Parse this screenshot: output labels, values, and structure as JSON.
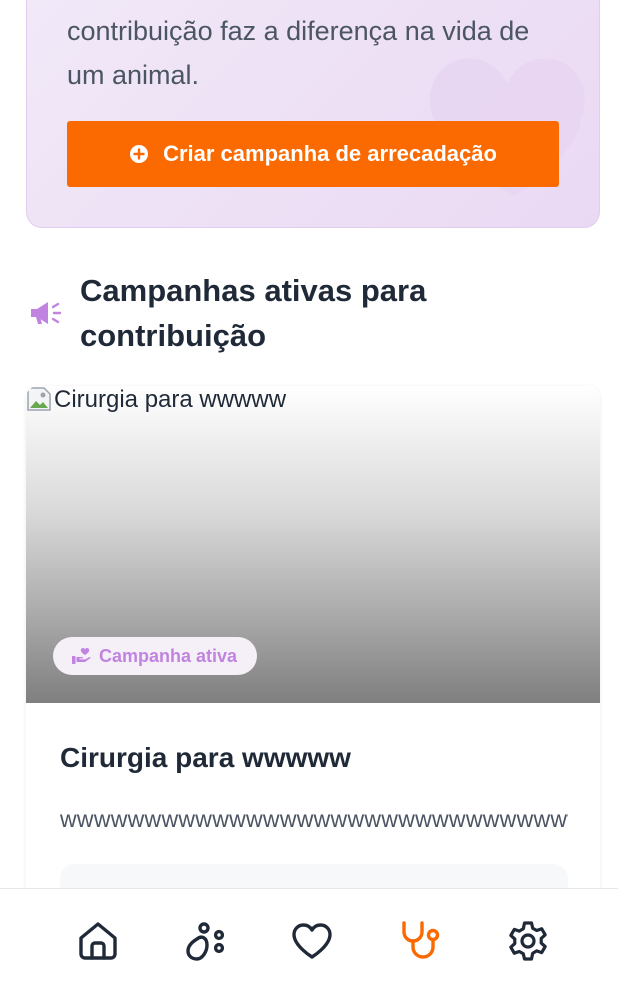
{
  "intro": {
    "text": "contribuição faz a diferença na vida de um animal.",
    "button_label": "Criar campanha de arrecadação"
  },
  "section": {
    "title": "Campanhas ativas para contribuição",
    "icon": "megaphone-icon"
  },
  "campaign": {
    "image_alt": "Cirurgia para wwwww",
    "status": "Campanha ativa",
    "name": "Cirurgia para wwwww",
    "description": "wwwwwwwwwwwwwwwwwwwwwwwwwwwwwwwwwwwwww"
  },
  "nav": {
    "items": [
      {
        "name": "home",
        "icon": "home-icon"
      },
      {
        "name": "pets",
        "icon": "paw-icon"
      },
      {
        "name": "favorites",
        "icon": "heart-icon"
      },
      {
        "name": "health",
        "icon": "stethoscope-icon",
        "active": true
      },
      {
        "name": "settings",
        "icon": "gear-icon"
      }
    ]
  },
  "colors": {
    "accent": "#fb6a00",
    "purple": "#c084e0",
    "text_dark": "#1f2937",
    "text_muted": "#4b5563"
  }
}
